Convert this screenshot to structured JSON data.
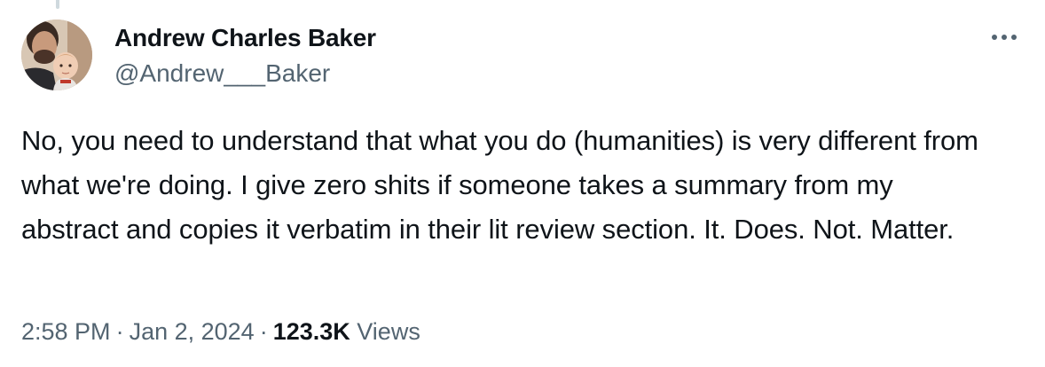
{
  "thread_line_color": "#cfd9de",
  "author": {
    "display_name": "Andrew Charles Baker",
    "handle": "@Andrew___Baker"
  },
  "tweet": {
    "text": "No, you need to understand that what you do (humanities) is very different from what we're doing. I give zero shits if someone takes a summary from my abstract and copies it verbatim in their lit review section. It. Does. Not. Matter.",
    "time": "2:58 PM",
    "date": "Jan 2, 2024",
    "separator": "·",
    "views_count": "123.3K",
    "views_label": "Views"
  },
  "icons": {
    "more": "more-horizontal-icon"
  },
  "colors": {
    "text_primary": "#0f1419",
    "text_secondary": "#536471"
  }
}
